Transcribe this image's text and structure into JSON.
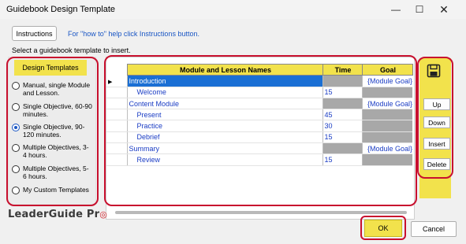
{
  "window": {
    "title": "Guidebook Design Template",
    "minimize_glyph": "—",
    "maximize_glyph": "☐",
    "close_glyph": "✕"
  },
  "toolbar": {
    "instructions_label": "Instructions",
    "hint": "For \"how to\" help click Instructions button."
  },
  "prompt": "Select a guidebook template to insert.",
  "design_templates": {
    "header": "Design Templates",
    "options": [
      {
        "label": "Manual, single Module and Lesson.",
        "checked": false
      },
      {
        "label": "Single Objective, 60-90 minutes.",
        "checked": false
      },
      {
        "label": "Single Objective, 90-120 minutes.",
        "checked": true
      },
      {
        "label": "Multiple Objectives, 3-4 hours.",
        "checked": false
      },
      {
        "label": "Multiple Objectives, 5-6 hours.",
        "checked": false
      },
      {
        "label": "My Custom Templates",
        "checked": false
      }
    ]
  },
  "grid": {
    "columns": [
      "Module and Lesson Names",
      "Time",
      "Goal"
    ],
    "rows": [
      {
        "name": "Introduction",
        "level": 0,
        "time": "",
        "goal": "{Module Goal}",
        "selected": true
      },
      {
        "name": "Welcome",
        "level": 1,
        "time": "15",
        "goal": "",
        "selected": false
      },
      {
        "name": "Content Module",
        "level": 0,
        "time": "",
        "goal": "{Module Goal}",
        "selected": false
      },
      {
        "name": "Present",
        "level": 1,
        "time": "45",
        "goal": "",
        "selected": false
      },
      {
        "name": "Practice",
        "level": 1,
        "time": "30",
        "goal": "",
        "selected": false
      },
      {
        "name": "Debrief",
        "level": 1,
        "time": "15",
        "goal": "",
        "selected": false
      },
      {
        "name": "Summary",
        "level": 0,
        "time": "",
        "goal": "{Module Goal}",
        "selected": false
      },
      {
        "name": "Review",
        "level": 1,
        "time": "15",
        "goal": "",
        "selected": false
      }
    ]
  },
  "side_buttons": {
    "save_icon": "floppy-disk-icon",
    "up": "Up",
    "down": "Down",
    "insert": "Insert",
    "delete": "Delete"
  },
  "footer": {
    "logo_text": "LeaderGuide Pr",
    "logo_mark": "◎",
    "ok": "OK",
    "cancel": "Cancel"
  },
  "colors": {
    "highlight_yellow": "#f2e24c",
    "annotation_red": "#c8102e",
    "link_blue": "#1a3cc4",
    "selection_blue": "#1a6fd4"
  }
}
